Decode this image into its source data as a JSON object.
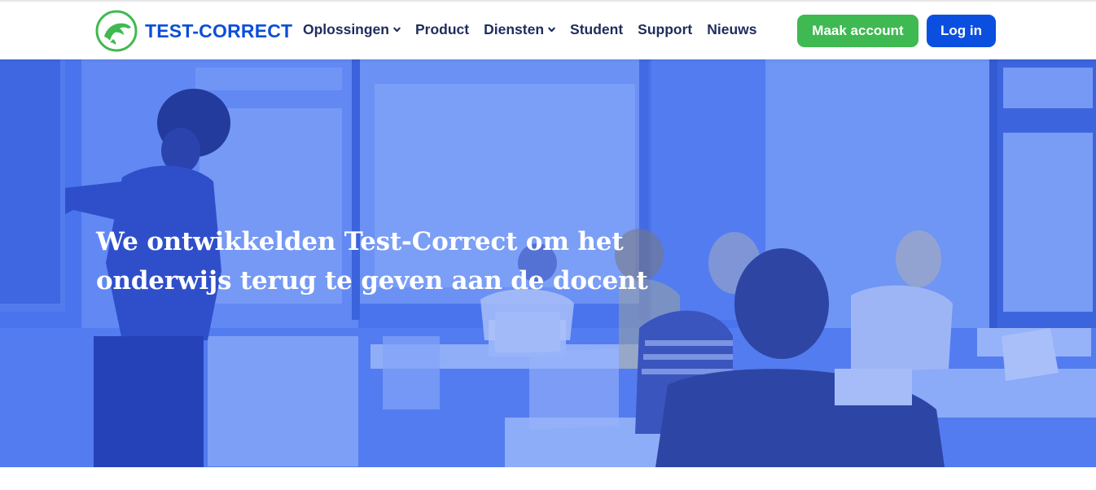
{
  "header": {
    "logo": {
      "name": "TEST-CORRECT",
      "icon": "dolphin-icon",
      "color": "#0b4fd8",
      "icon_color": "#3fb951"
    },
    "nav": [
      {
        "label": "Oplossingen",
        "has_dropdown": true
      },
      {
        "label": "Product",
        "has_dropdown": false
      },
      {
        "label": "Diensten",
        "has_dropdown": true
      },
      {
        "label": "Student",
        "has_dropdown": false
      },
      {
        "label": "Support",
        "has_dropdown": false
      },
      {
        "label": "Nieuws",
        "has_dropdown": false
      }
    ],
    "make_account_label": "Maak account",
    "login_label": "Log in",
    "colors": {
      "nav_text": "#1f2d5c",
      "account_button": "#3fb951",
      "login_button": "#0b4fe0"
    }
  },
  "hero": {
    "title_line1": "We ontwikkelden Test-Correct om het",
    "title_line2": "onderwijs terug te geven aan de docent",
    "overlay_color": "#4c74ee"
  }
}
